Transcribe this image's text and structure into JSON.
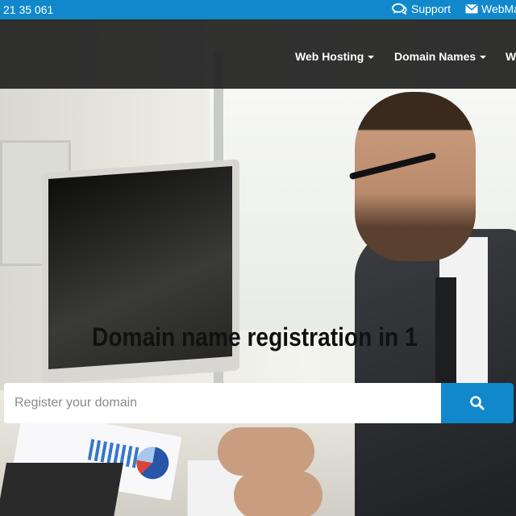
{
  "topbar": {
    "phone": "21 35 061",
    "support_label": "Support",
    "webmail_label": "WebMa"
  },
  "nav": {
    "items": [
      {
        "label": "Web Hosting"
      },
      {
        "label": "Domain Names"
      },
      {
        "label": "We"
      }
    ]
  },
  "hero": {
    "headline": "Domain name registration in 1"
  },
  "search": {
    "placeholder": "Register your domain",
    "button_icon": "search-icon"
  },
  "colors": {
    "brand_blue": "#1188cc",
    "nav_overlay": "#1c1c1c"
  }
}
